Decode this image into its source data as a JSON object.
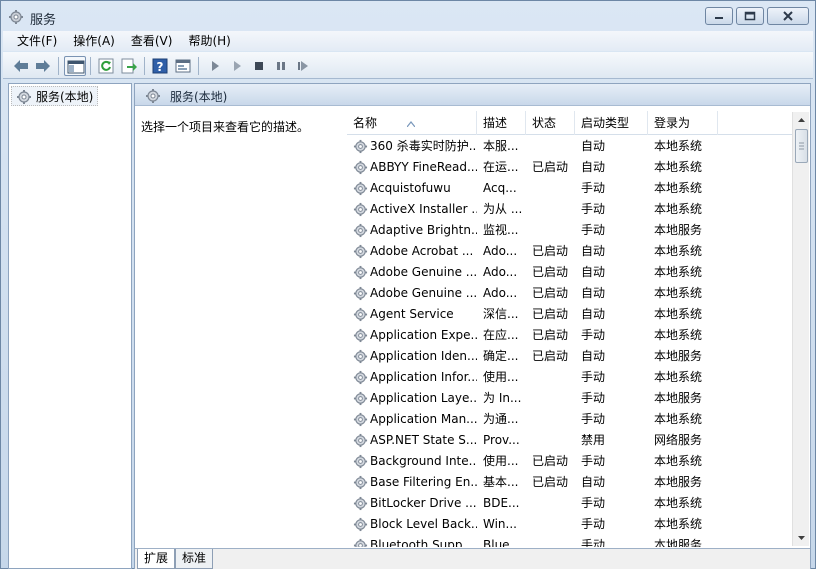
{
  "window": {
    "title": "服务",
    "icon": "services-gear-icon"
  },
  "menu": [
    "文件(F)",
    "操作(A)",
    "查看(V)",
    "帮助(H)"
  ],
  "toolbar": {
    "buttons": [
      "back-arrow-icon",
      "forward-arrow-icon",
      "show-hide-console-tree-icon",
      "refresh-icon",
      "export-list-icon",
      "help-icon",
      "properties-pane-icon",
      "start-service-icon",
      "start-service-alt-icon",
      "stop-service-icon",
      "pause-service-icon",
      "restart-service-icon"
    ]
  },
  "tree": {
    "item_label": "服务(本地)"
  },
  "pane": {
    "header_title": "服务(本地)",
    "description_prompt": "选择一个项目来查看它的描述。"
  },
  "columns": {
    "name": "名称",
    "desc": "描述",
    "status": "状态",
    "startup": "启动类型",
    "logon": "登录为"
  },
  "services": [
    {
      "name": "360 杀毒实时防护...",
      "desc": "本服...",
      "status": "",
      "startup": "自动",
      "logon": "本地系统"
    },
    {
      "name": "ABBYY FineRead...",
      "desc": "在运...",
      "status": "已启动",
      "startup": "自动",
      "logon": "本地系统"
    },
    {
      "name": "Acquistofuwu",
      "desc": "Acq...",
      "status": "",
      "startup": "手动",
      "logon": "本地系统"
    },
    {
      "name": "ActiveX Installer ...",
      "desc": "为从 ...",
      "status": "",
      "startup": "手动",
      "logon": "本地系统"
    },
    {
      "name": "Adaptive Brightn...",
      "desc": "监视...",
      "status": "",
      "startup": "手动",
      "logon": "本地服务"
    },
    {
      "name": "Adobe Acrobat ...",
      "desc": "Ado...",
      "status": "已启动",
      "startup": "自动",
      "logon": "本地系统"
    },
    {
      "name": "Adobe Genuine ...",
      "desc": "Ado...",
      "status": "已启动",
      "startup": "自动",
      "logon": "本地系统"
    },
    {
      "name": "Adobe Genuine ...",
      "desc": "Ado...",
      "status": "已启动",
      "startup": "自动",
      "logon": "本地系统"
    },
    {
      "name": "Agent Service",
      "desc": "深信...",
      "status": "已启动",
      "startup": "自动",
      "logon": "本地系统"
    },
    {
      "name": "Application Expe...",
      "desc": "在应...",
      "status": "已启动",
      "startup": "手动",
      "logon": "本地系统"
    },
    {
      "name": "Application Iden...",
      "desc": "确定...",
      "status": "已启动",
      "startup": "自动",
      "logon": "本地服务"
    },
    {
      "name": "Application Infor...",
      "desc": "使用...",
      "status": "",
      "startup": "手动",
      "logon": "本地系统"
    },
    {
      "name": "Application Laye...",
      "desc": "为 In...",
      "status": "",
      "startup": "手动",
      "logon": "本地服务"
    },
    {
      "name": "Application Man...",
      "desc": "为通...",
      "status": "",
      "startup": "手动",
      "logon": "本地系统"
    },
    {
      "name": "ASP.NET State S...",
      "desc": "Prov...",
      "status": "",
      "startup": "禁用",
      "logon": "网络服务"
    },
    {
      "name": "Background Inte...",
      "desc": "使用...",
      "status": "已启动",
      "startup": "手动",
      "logon": "本地系统"
    },
    {
      "name": "Base Filtering En...",
      "desc": "基本...",
      "status": "已启动",
      "startup": "自动",
      "logon": "本地服务"
    },
    {
      "name": "BitLocker Drive ...",
      "desc": "BDE...",
      "status": "",
      "startup": "手动",
      "logon": "本地系统"
    },
    {
      "name": "Block Level Back...",
      "desc": "Win...",
      "status": "",
      "startup": "手动",
      "logon": "本地系统"
    },
    {
      "name": "Bluetooth Supp...",
      "desc": "Blue...",
      "status": "",
      "startup": "手动",
      "logon": "本地服务"
    }
  ],
  "tabs": [
    "扩展",
    "标准"
  ]
}
